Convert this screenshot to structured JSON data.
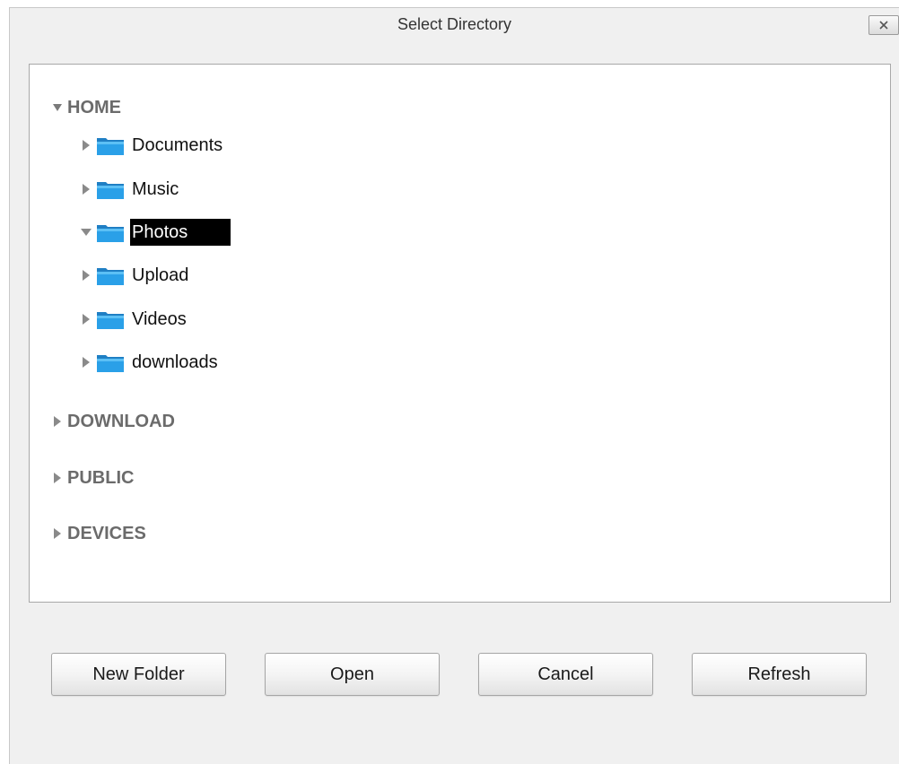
{
  "dialog": {
    "title": "Select Directory",
    "close_icon": "close-icon"
  },
  "tree": {
    "roots": [
      {
        "label": "HOME",
        "expanded": true,
        "children": [
          {
            "label": "Documents",
            "expanded": false,
            "selected": false
          },
          {
            "label": "Music",
            "expanded": false,
            "selected": false
          },
          {
            "label": "Photos",
            "expanded": true,
            "selected": true
          },
          {
            "label": "Upload",
            "expanded": false,
            "selected": false
          },
          {
            "label": "Videos",
            "expanded": false,
            "selected": false
          },
          {
            "label": "downloads",
            "expanded": false,
            "selected": false
          }
        ]
      },
      {
        "label": "DOWNLOAD",
        "expanded": false
      },
      {
        "label": "PUBLIC",
        "expanded": false
      },
      {
        "label": "DEVICES",
        "expanded": false
      }
    ]
  },
  "buttons": {
    "new_folder": "New Folder",
    "open": "Open",
    "cancel": "Cancel",
    "refresh": "Refresh"
  },
  "colors": {
    "folder_blue": "#2aa0e8",
    "selection_bg": "#000000",
    "root_text": "#6b6b6b"
  }
}
